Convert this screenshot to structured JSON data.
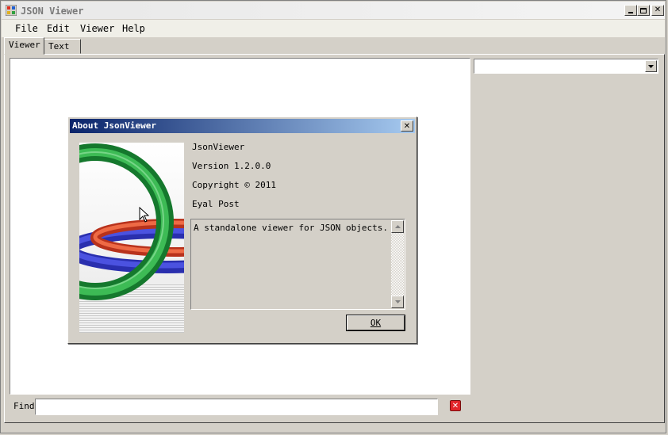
{
  "window": {
    "title": "JSON Viewer",
    "icon": "json-viewer-app-icon",
    "controls": {
      "minimize": "minimize-icon",
      "maximize": "maximize-icon",
      "close": "close-icon"
    }
  },
  "menu": {
    "items": [
      {
        "label": "File"
      },
      {
        "label": "Edit"
      },
      {
        "label": "Viewer"
      },
      {
        "label": "Help"
      }
    ]
  },
  "tabs": [
    {
      "label": "Viewer",
      "selected": true
    },
    {
      "label": "Text",
      "selected": false
    }
  ],
  "find": {
    "label": "Find",
    "value": "",
    "close_icon": "red-close-icon"
  },
  "right_panel": {
    "combo_value": ""
  },
  "about_dialog": {
    "title": "About JsonViewer",
    "product": "JsonViewer",
    "version": "Version 1.2.0.0",
    "copyright": "Copyright ©  2011",
    "company": "Eyal Post",
    "description": "A standalone viewer for JSON objects.",
    "ok_label": "OK",
    "colors": {
      "title_start": "#0a246a",
      "title_end": "#a6caf0",
      "ring_green": "#1f9a3c",
      "ring_red": "#d8452a",
      "ring_blue": "#3a3fc4"
    }
  }
}
